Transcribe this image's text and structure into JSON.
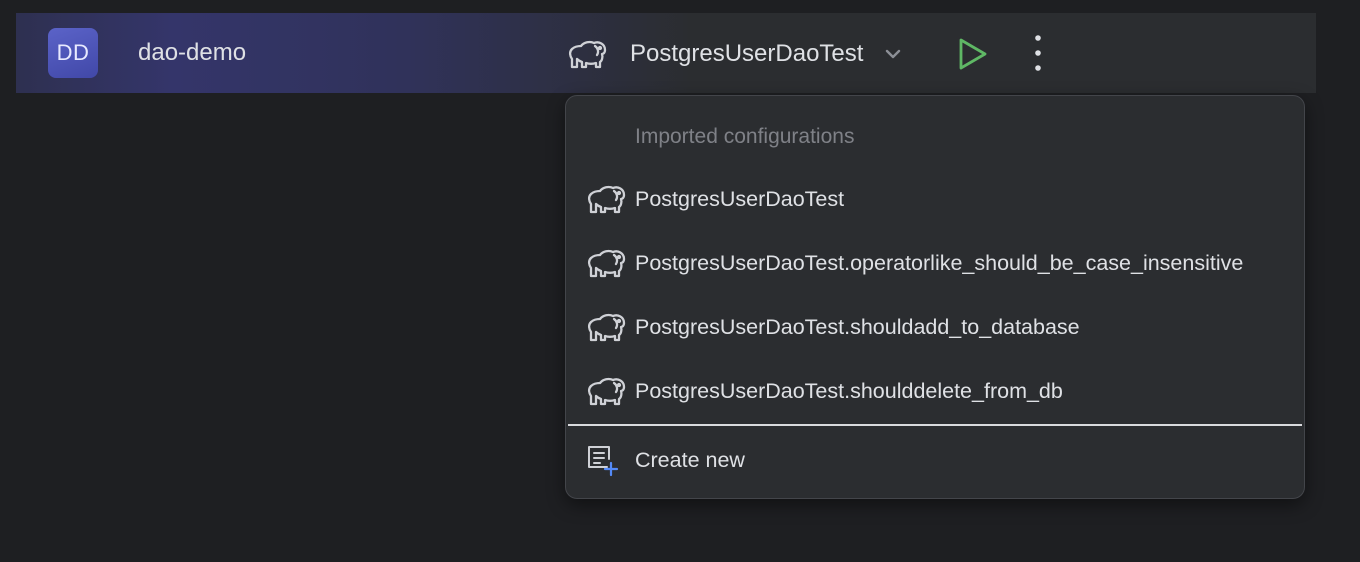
{
  "toolbar": {
    "avatar_initials": "DD",
    "project_name": "dao-demo",
    "run_config_label": "PostgresUserDaoTest",
    "colors": {
      "run_green": "#5fb865",
      "accent_blue": "#548af7"
    }
  },
  "popup": {
    "section_title": "Imported configurations",
    "items": [
      {
        "label": "PostgresUserDaoTest",
        "icon": "elephant-icon"
      },
      {
        "label": "PostgresUserDaoTest.operatorlike_should_be_case_insensitive",
        "icon": "elephant-icon"
      },
      {
        "label": "PostgresUserDaoTest.shouldadd_to_database",
        "icon": "elephant-icon"
      },
      {
        "label": "PostgresUserDaoTest.shoulddelete_from_db",
        "icon": "elephant-icon"
      }
    ],
    "create_new_label": "Create new",
    "create_new_icon": "add-config-icon"
  }
}
